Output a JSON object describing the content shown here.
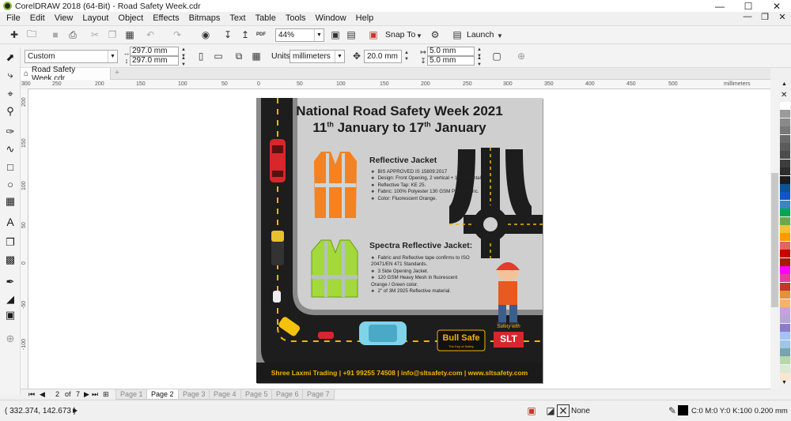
{
  "window": {
    "title": "CorelDRAW 2018 (64-Bit) - Road Safety Week.cdr",
    "minimize": "—",
    "maximize": "☐",
    "close": "✕"
  },
  "menu": [
    "File",
    "Edit",
    "View",
    "Layout",
    "Object",
    "Effects",
    "Bitmaps",
    "Text",
    "Table",
    "Tools",
    "Window",
    "Help"
  ],
  "mdi_controls": {
    "minimize": "—",
    "restore": "❐",
    "close": "✕"
  },
  "toolbar": {
    "zoom": "44%",
    "snap_to": "Snap To",
    "launch": "Launch",
    "pdf_label": "PDF"
  },
  "property_bar": {
    "page_preset": "Custom",
    "width": "297.0 mm",
    "height": "297.0 mm",
    "units_label": "Units:",
    "units": "millimeters",
    "nudge": "20.0 mm",
    "dup_x": "5.0 mm",
    "dup_y": "5.0 mm"
  },
  "document_tab": {
    "name": "Road Safety Week.cdr",
    "add": "+"
  },
  "ruler": {
    "h_labels": [
      "300",
      "250",
      "200",
      "150",
      "100",
      "50",
      "0",
      "50",
      "100",
      "150",
      "200",
      "250",
      "300",
      "350",
      "400",
      "450",
      "500"
    ],
    "unit": "millimeters",
    "v_labels": [
      "200",
      "150",
      "100",
      "50",
      "0",
      "-50",
      "-100"
    ]
  },
  "pages": {
    "counter": "2",
    "of": "of",
    "total": "7",
    "tabs": [
      "Page 1",
      "Page 2",
      "Page 3",
      "Page 4",
      "Page 5",
      "Page 6",
      "Page 7"
    ],
    "active": 1
  },
  "status": {
    "coords": "( 332.374, 142.673 )",
    "fill": "None",
    "outline": "C:0 M:0 Y:0 K:100  0.200 mm"
  },
  "palette": [
    "#ffffff",
    "#9b9b9b",
    "#8a8a8a",
    "#797979",
    "#6a6a6a",
    "#5b5b5b",
    "#4c4c4c",
    "#3d3d3d",
    "#2d2d2d",
    "#1c1c1c",
    "#0b5394",
    "#1155cc",
    "#3d85c6",
    "#00a651",
    "#6aa84f",
    "#f1c232",
    "#ff9900",
    "#e06666",
    "#cc0000",
    "#a61c00",
    "#ff00ff",
    "#e040a0",
    "#c0392b",
    "#e69138",
    "#f6b26b",
    "#c9a0dc",
    "#b4a7d6",
    "#8e7cc3",
    "#a4c2f4",
    "#9fc5e8",
    "#76a5af",
    "#b6d7a8",
    "#d9ead3",
    "#fce5cd"
  ],
  "poster": {
    "title_line1": "National Road Safety Week 2021",
    "date_11": "11",
    "date_sup1": "th",
    "date_mid": "January to 17",
    "date_sup2": "th",
    "date_end": "January",
    "jacket1_heading": "Reflective Jacket",
    "jacket1_points": [
      "BIS APPROVED IS 15809:2017",
      "Design: Front Opening, 2 vertical + 1 Horizontal.",
      "Reflective Tap: KE 25.",
      "Fabric: 100% Polyester 130 GSM Plain Fabric.",
      "Color: Fluorescent Orange."
    ],
    "jacket2_heading": "Spectra Reflective Jacket:",
    "jacket2_points": [
      "Fabric and Reflective tape confirms to ISO 20471/EN 471 Standards.",
      "3 Side Opening Jacket.",
      "120 GSM Heavy Mesh in fluorescent Orange / Green color.",
      "2\" of 3M 2925 Reflective material."
    ],
    "brand1": "Bull Safe",
    "brand1_tag": "The Key of Safety",
    "brand2_tag": "Safety with",
    "brand2": "SLT",
    "footer": "Shree Laxmi Trading | +91 99255 74508 | info@sltsafety.com | www.sltsafety.com"
  }
}
